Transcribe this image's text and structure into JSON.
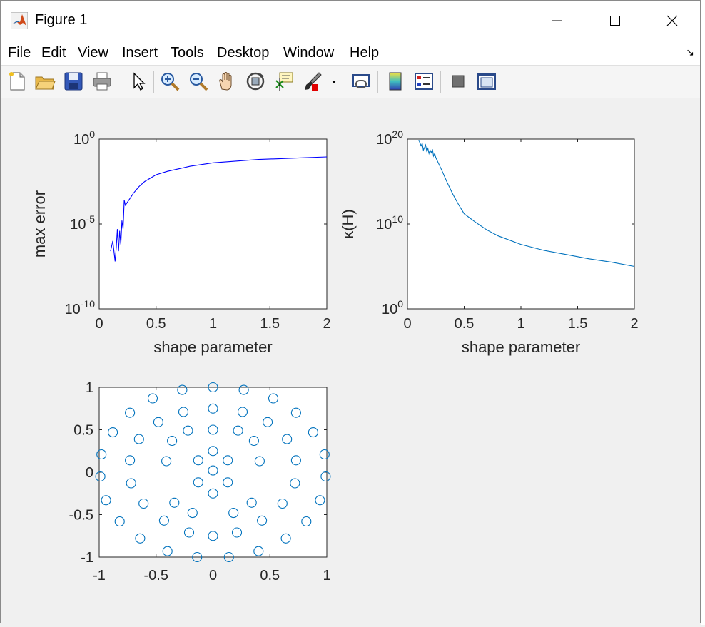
{
  "window": {
    "title": "Figure 1"
  },
  "menu": [
    "File",
    "Edit",
    "View",
    "Insert",
    "Tools",
    "Desktop",
    "Window",
    "Help"
  ],
  "toolbar_icons": [
    "new-figure-icon",
    "open-file-icon",
    "save-icon",
    "print-icon",
    "select-pointer-icon",
    "zoom-in-icon",
    "zoom-out-icon",
    "pan-hand-icon",
    "rotate-3d-icon",
    "data-cursor-icon",
    "brush-icon",
    "link-plot-icon",
    "insert-colorbar-icon",
    "insert-legend-icon",
    "hide-plot-tools-icon",
    "show-plot-tools-icon"
  ],
  "colors": {
    "series_blue": "#0000ff",
    "series_matlab": "#0072bd"
  },
  "chart_data": [
    {
      "type": "line",
      "id": "error",
      "xlabel": "shape parameter",
      "ylabel": "max error",
      "xlim": [
        0,
        2
      ],
      "ylim_log10": [
        -10,
        0
      ],
      "yscale": "log",
      "xticks": [
        "0",
        "0.5",
        "1",
        "1.5",
        "2"
      ],
      "yticks": [
        {
          "base": "10",
          "exp": "0",
          "value": 0
        },
        {
          "base": "10",
          "exp": "-5",
          "value": -5
        },
        {
          "base": "10",
          "exp": "-10",
          "value": -10
        }
      ],
      "x": [
        0.1,
        0.12,
        0.14,
        0.15,
        0.16,
        0.17,
        0.18,
        0.19,
        0.2,
        0.21,
        0.22,
        0.23,
        0.24,
        0.25,
        0.26,
        0.28,
        0.3,
        0.35,
        0.4,
        0.5,
        0.6,
        0.7,
        0.8,
        1.0,
        1.2,
        1.4,
        1.6,
        1.8,
        2.0
      ],
      "y_log10": [
        -6.6,
        -6.0,
        -7.2,
        -6.4,
        -5.3,
        -6.6,
        -5.4,
        -6.2,
        -4.8,
        -5.3,
        -3.6,
        -3.9,
        -3.8,
        -3.7,
        -3.6,
        -3.4,
        -3.2,
        -2.8,
        -2.5,
        -2.1,
        -1.9,
        -1.75,
        -1.6,
        -1.4,
        -1.3,
        -1.2,
        -1.15,
        -1.1,
        -1.05
      ]
    },
    {
      "type": "line",
      "id": "condition",
      "xlabel": "shape parameter",
      "ylabel": "κ(H)",
      "xlim": [
        0,
        2
      ],
      "ylim_log10": [
        0,
        20
      ],
      "yscale": "log",
      "xticks": [
        "0",
        "0.5",
        "1",
        "1.5",
        "2"
      ],
      "yticks": [
        {
          "base": "10",
          "exp": "20",
          "value": 20
        },
        {
          "base": "10",
          "exp": "10",
          "value": 10
        },
        {
          "base": "10",
          "exp": "0",
          "value": 0
        }
      ],
      "x": [
        0.1,
        0.12,
        0.13,
        0.14,
        0.15,
        0.16,
        0.17,
        0.18,
        0.19,
        0.2,
        0.21,
        0.22,
        0.23,
        0.24,
        0.25,
        0.3,
        0.35,
        0.4,
        0.45,
        0.5,
        0.6,
        0.7,
        0.8,
        1.0,
        1.2,
        1.4,
        1.6,
        1.8,
        2.0
      ],
      "y_log10": [
        19.9,
        19.2,
        19.5,
        18.7,
        19.0,
        19.3,
        18.6,
        18.9,
        18.3,
        18.7,
        18.4,
        18.8,
        18.0,
        18.3,
        17.8,
        16.4,
        14.9,
        13.5,
        12.3,
        11.2,
        10.2,
        9.3,
        8.6,
        7.6,
        6.9,
        6.4,
        5.9,
        5.5,
        5.0
      ]
    },
    {
      "type": "scatter",
      "id": "nodes",
      "xlim": [
        -1,
        1
      ],
      "ylim": [
        -1,
        1
      ],
      "xticks": [
        "-1",
        "-0.5",
        "0",
        "0.5",
        "1"
      ],
      "yticks": [
        "1",
        "0.5",
        "0",
        "-0.5",
        "-1"
      ],
      "marker": "open-circle",
      "x": [
        0.0,
        0.27,
        0.53,
        0.73,
        0.88,
        0.98,
        0.99,
        0.94,
        0.82,
        0.64,
        0.4,
        0.14,
        -0.14,
        -0.4,
        -0.64,
        -0.82,
        -0.94,
        -0.99,
        -0.98,
        -0.88,
        -0.73,
        -0.53,
        -0.27,
        0.0,
        0.26,
        0.48,
        0.65,
        0.73,
        0.72,
        0.61,
        0.43,
        0.21,
        0.0,
        -0.21,
        -0.43,
        -0.61,
        -0.72,
        -0.73,
        -0.65,
        -0.48,
        -0.26,
        0.0,
        0.22,
        0.36,
        0.41,
        0.34,
        0.18,
        0.0,
        -0.18,
        -0.34,
        -0.41,
        -0.36,
        -0.22,
        0.0,
        0.13,
        0.13,
        0.0,
        -0.13,
        -0.13
      ],
      "y": [
        1.0,
        0.97,
        0.87,
        0.7,
        0.47,
        0.21,
        -0.05,
        -0.33,
        -0.58,
        -0.78,
        -0.93,
        -1.0,
        -1.0,
        -0.93,
        -0.78,
        -0.58,
        -0.33,
        -0.05,
        0.21,
        0.47,
        0.7,
        0.87,
        0.97,
        0.75,
        0.71,
        0.59,
        0.39,
        0.14,
        -0.13,
        -0.37,
        -0.57,
        -0.71,
        -0.75,
        -0.71,
        -0.57,
        -0.37,
        -0.13,
        0.14,
        0.39,
        0.59,
        0.71,
        0.5,
        0.49,
        0.37,
        0.13,
        -0.36,
        -0.48,
        -0.25,
        -0.48,
        -0.36,
        0.13,
        0.37,
        0.49,
        0.25,
        0.14,
        -0.12,
        0.02,
        0.14,
        -0.12
      ]
    }
  ]
}
